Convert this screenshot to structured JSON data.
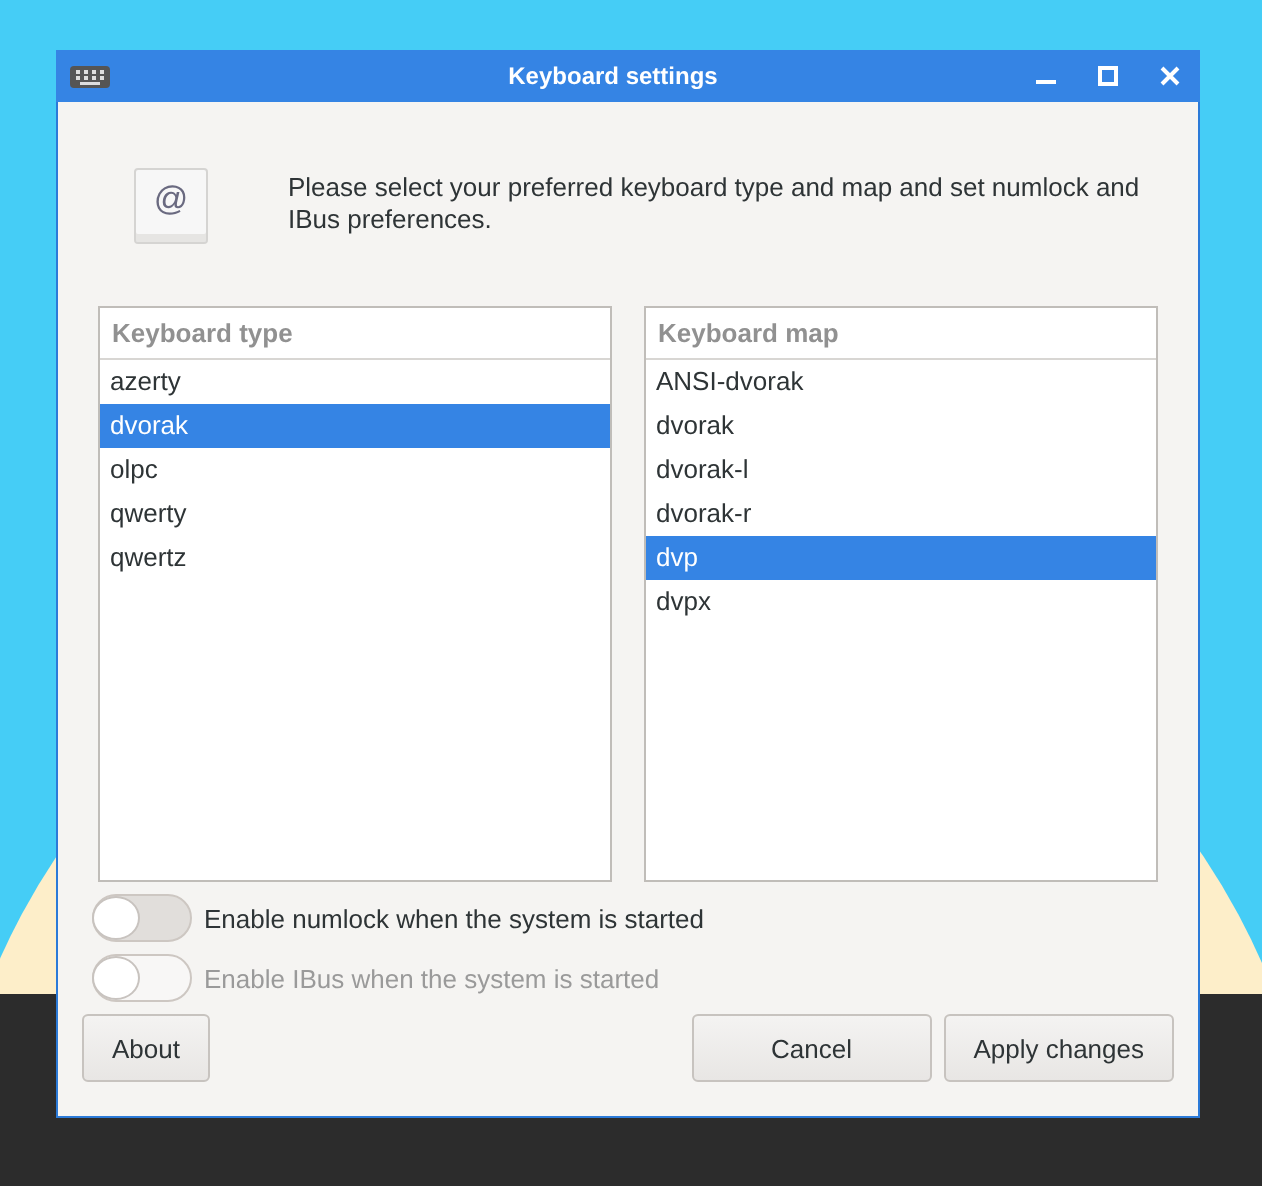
{
  "window": {
    "title": "Keyboard settings"
  },
  "intro": "Please select your preferred keyboard type and map and set numlock and IBus preferences.",
  "intro_icon_glyph": "@",
  "lists": [
    {
      "heading": "Keyboard type",
      "items": [
        {
          "label": "azerty",
          "selected": false
        },
        {
          "label": "dvorak",
          "selected": true
        },
        {
          "label": "olpc",
          "selected": false
        },
        {
          "label": "qwerty",
          "selected": false
        },
        {
          "label": "qwertz",
          "selected": false
        }
      ]
    },
    {
      "heading": "Keyboard map",
      "items": [
        {
          "label": "ANSI-dvorak",
          "selected": false
        },
        {
          "label": "dvorak",
          "selected": false
        },
        {
          "label": "dvorak-l",
          "selected": false
        },
        {
          "label": "dvorak-r",
          "selected": false
        },
        {
          "label": "dvp",
          "selected": true
        },
        {
          "label": "dvpx",
          "selected": false
        }
      ]
    }
  ],
  "toggles": [
    {
      "label": "Enable numlock when the system is started",
      "on": false,
      "disabled": false
    },
    {
      "label": "Enable IBus when the system is started",
      "on": false,
      "disabled": true
    }
  ],
  "buttons": {
    "left": [
      "About"
    ],
    "right": [
      "Cancel",
      "Apply changes"
    ]
  }
}
